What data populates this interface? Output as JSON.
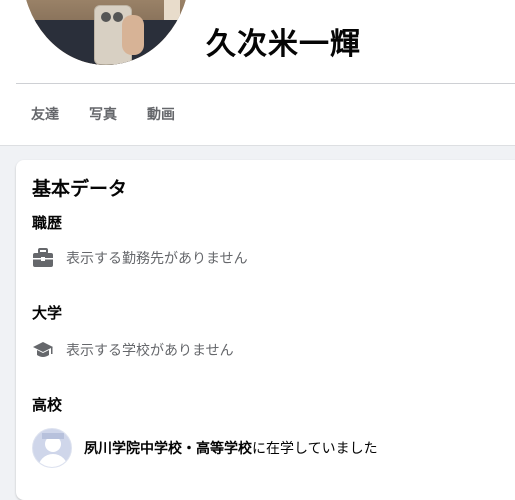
{
  "profile": {
    "name": "久次米一輝"
  },
  "tabs": [
    {
      "label": "友達"
    },
    {
      "label": "写真"
    },
    {
      "label": "動画"
    }
  ],
  "card": {
    "title": "基本データ",
    "sections": {
      "work": {
        "title": "職歴",
        "icon": "briefcase-icon",
        "text": "表示する勤務先がありません"
      },
      "university": {
        "title": "大学",
        "icon": "graduation-cap-icon",
        "text": "表示する学校がありません"
      },
      "high_school": {
        "title": "高校",
        "school_name": "夙川学院中学校・高等学校",
        "suffix": "に在学していました"
      }
    }
  },
  "colors": {
    "background": "#f0f2f5",
    "card": "#ffffff",
    "secondary_text": "#65676b",
    "icon": "#65676b"
  }
}
